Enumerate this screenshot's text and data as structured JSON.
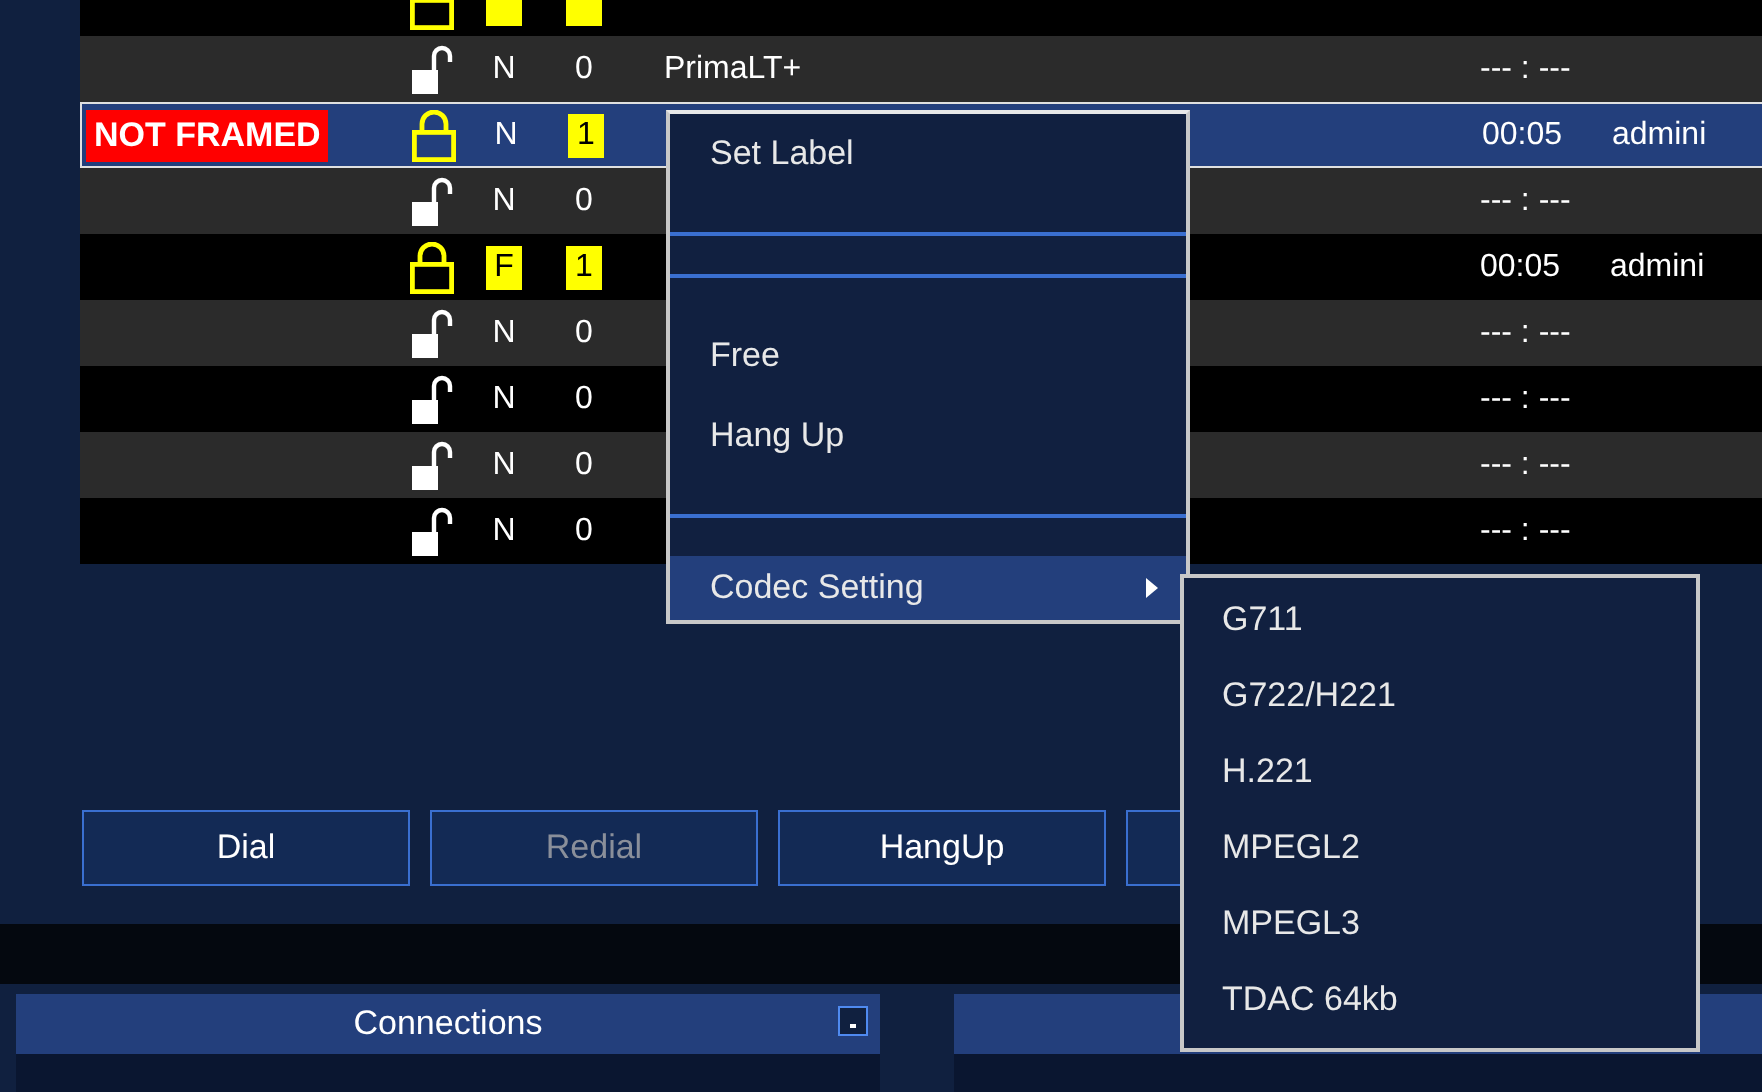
{
  "table": {
    "rows": [
      {
        "badge": null,
        "locked": true,
        "status_flagged": true,
        "count_flagged": true,
        "selected": false
      },
      {
        "locked": false,
        "status": "N",
        "status_flagged": false,
        "count": "0",
        "count_flagged": false,
        "name": "PrimaLT+",
        "time": "--- : ---",
        "selected": false
      },
      {
        "badge": "NOT FRAMED",
        "locked": true,
        "status": "N",
        "status_flagged": false,
        "count": "1",
        "count_flagged": true,
        "time": "00:05",
        "user": "admini",
        "selected": true
      },
      {
        "locked": false,
        "status": "N",
        "status_flagged": false,
        "count": "0",
        "count_flagged": false,
        "time": "--- : ---",
        "selected": false
      },
      {
        "locked": true,
        "status": "F",
        "status_flagged": true,
        "count": "1",
        "count_flagged": true,
        "time": "00:05",
        "user": "admini",
        "selected": false
      },
      {
        "locked": false,
        "status": "N",
        "status_flagged": false,
        "count": "0",
        "count_flagged": false,
        "time": "--- : ---",
        "selected": false
      },
      {
        "locked": false,
        "status": "N",
        "status_flagged": false,
        "count": "0",
        "count_flagged": false,
        "time": "--- : ---",
        "selected": false
      },
      {
        "locked": false,
        "status": "N",
        "status_flagged": false,
        "count": "0",
        "count_flagged": false,
        "time": "--- : ---",
        "selected": false
      },
      {
        "locked": false,
        "status": "N",
        "status_flagged": false,
        "count": "0",
        "count_flagged": false,
        "time": "--- : ---",
        "selected": false
      }
    ]
  },
  "buttons": [
    {
      "label": "Dial",
      "disabled": false
    },
    {
      "label": "Redial",
      "disabled": true
    },
    {
      "label": "HangUp",
      "disabled": false
    }
  ],
  "context_menu": {
    "items": [
      {
        "kind": "item",
        "label": "Set Label",
        "selected": false
      },
      {
        "kind": "separator"
      },
      {
        "kind": "separator"
      },
      {
        "kind": "item",
        "label": "Free",
        "selected": false
      },
      {
        "kind": "item",
        "label": "Hang Up",
        "selected": false
      },
      {
        "kind": "separator"
      },
      {
        "kind": "submenu",
        "label": "Codec Setting",
        "selected": true
      }
    ],
    "submenu": {
      "items": [
        {
          "label": "G711",
          "selected": false
        },
        {
          "label": "G722/H221",
          "selected": false
        },
        {
          "label": "H.221",
          "selected": false
        },
        {
          "label": "MPEGL2",
          "selected": false
        },
        {
          "label": "MPEGL3",
          "selected": false
        },
        {
          "label": "TDAC 64kb",
          "selected": false
        }
      ]
    }
  },
  "panels": [
    {
      "title": "Connections",
      "minimize": true
    }
  ]
}
